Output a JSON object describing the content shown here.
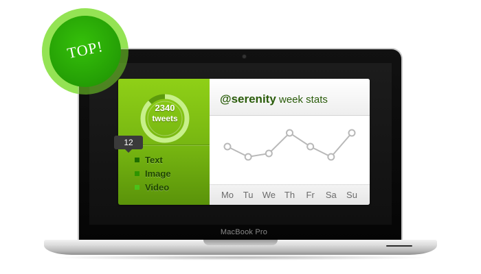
{
  "badge": {
    "label": "TOP!"
  },
  "laptop": {
    "brand_label": "MacBook Pro"
  },
  "widget": {
    "summary": {
      "count": "2340",
      "unit": "tweets",
      "ring_fraction": 0.88
    },
    "legend": [
      {
        "label": "Text",
        "color": "#1f6e00"
      },
      {
        "label": "Image",
        "color": "#2e9500"
      },
      {
        "label": "Video",
        "color": "#4cc21a"
      }
    ],
    "header": {
      "handle": "@serenity",
      "title": "week stats"
    },
    "tooltip": {
      "value": "12"
    },
    "chart_data": {
      "type": "line",
      "categories": [
        "Mo",
        "Tu",
        "We",
        "Th",
        "Fr",
        "Sa",
        "Su"
      ],
      "series": [
        {
          "values": [
            11,
            8,
            9,
            15,
            11,
            8,
            15
          ]
        }
      ],
      "ylim": [
        0,
        20
      ],
      "highlight_index": 1
    }
  },
  "colors": {
    "accent": "#7cbf14",
    "line": "#b8b8b8",
    "tooltip_bg": "#3a3a3a",
    "badge": "#2bb006"
  }
}
